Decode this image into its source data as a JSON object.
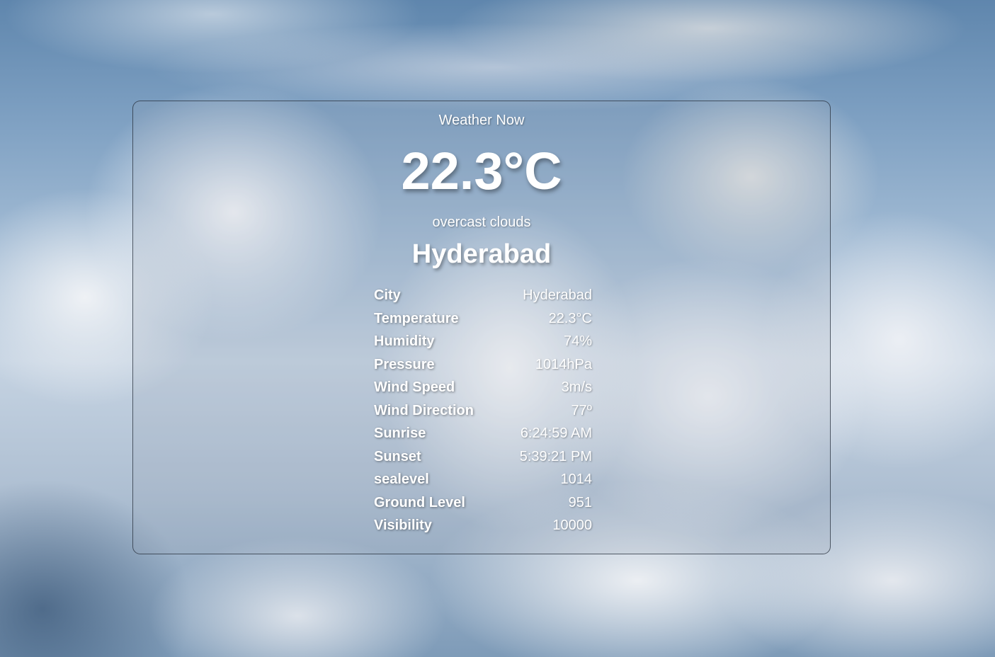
{
  "header": {
    "title": "Weather Now",
    "temperature": "22.3°C",
    "description": "overcast clouds",
    "city": "Hyderabad"
  },
  "details": [
    {
      "label": "City",
      "value": "Hyderabad"
    },
    {
      "label": "Temperature",
      "value": "22.3°C"
    },
    {
      "label": "Humidity",
      "value": "74%"
    },
    {
      "label": "Pressure",
      "value": "1014hPa"
    },
    {
      "label": "Wind Speed",
      "value": "3m/s"
    },
    {
      "label": "Wind Direction",
      "value": "77º"
    },
    {
      "label": "Sunrise",
      "value": "6:24:59 AM"
    },
    {
      "label": "Sunset",
      "value": "5:39:21 PM"
    },
    {
      "label": "sealevel",
      "value": "1014"
    },
    {
      "label": "Ground Level",
      "value": "951"
    },
    {
      "label": "Visibility",
      "value": "10000"
    }
  ]
}
